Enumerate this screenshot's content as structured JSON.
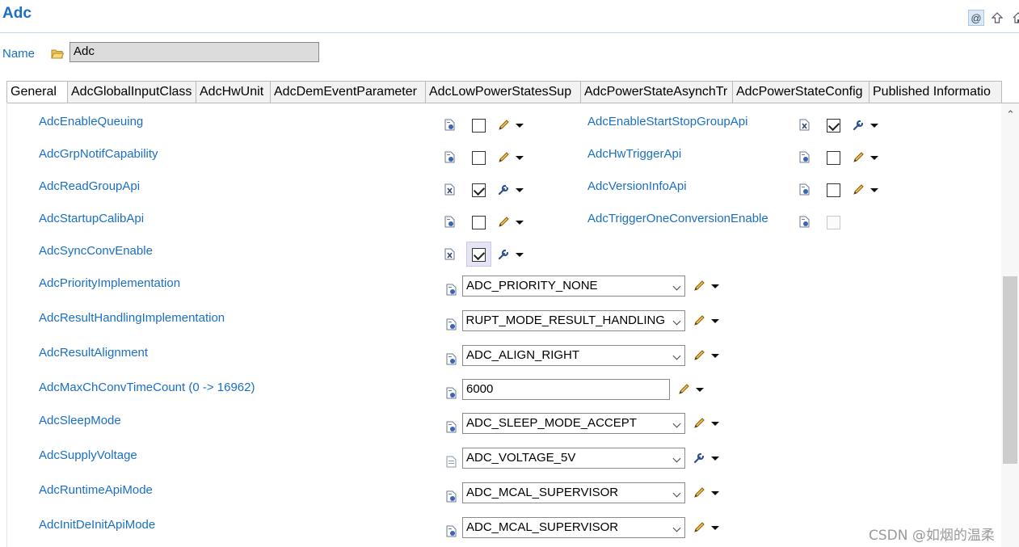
{
  "header": {
    "title": "Adc"
  },
  "header_icons": [
    "at-icon",
    "up-arrow-icon",
    "home-icon"
  ],
  "name_field": {
    "label": "Name",
    "value": "Adc"
  },
  "tabs": [
    {
      "label": "General",
      "active": true
    },
    {
      "label": "AdcGlobalInputClass"
    },
    {
      "label": "AdcHwUnit"
    },
    {
      "label": "AdcDemEventParameter"
    },
    {
      "label": "AdcLowPowerStatesSup"
    },
    {
      "label": "AdcPowerStateAsynchTr"
    },
    {
      "label": "AdcPowerStateConfig"
    },
    {
      "label": "Published Informatio"
    }
  ],
  "checkbox_rows": {
    "left": [
      {
        "label": "AdcEnableQueuing",
        "checked": false,
        "icon": "doc-pin-icon",
        "action_icon": "pencil-icon"
      },
      {
        "label": "AdcGrpNotifCapability",
        "checked": false,
        "icon": "doc-pin-icon",
        "action_icon": "pencil-icon"
      },
      {
        "label": "AdcReadGroupApi",
        "checked": true,
        "icon": "doc-x-icon",
        "action_icon": "wrench-icon"
      },
      {
        "label": "AdcStartupCalibApi",
        "checked": false,
        "icon": "doc-pin-icon",
        "action_icon": "pencil-icon"
      },
      {
        "label": "AdcSyncConvEnable",
        "checked": true,
        "icon": "doc-x-icon",
        "action_icon": "wrench-icon"
      }
    ],
    "right": [
      {
        "label": "AdcEnableStartStopGroupApi",
        "checked": true,
        "icon": "doc-x-icon",
        "action_icon": "wrench-icon"
      },
      {
        "label": "AdcHwTriggerApi",
        "checked": false,
        "icon": "doc-pin-icon",
        "action_icon": "pencil-icon"
      },
      {
        "label": "AdcVersionInfoApi",
        "checked": false,
        "icon": "doc-pin-icon",
        "action_icon": "pencil-icon"
      },
      {
        "label": "AdcTriggerOneConversionEnable",
        "checked": false,
        "disabled": true,
        "icon": "doc-pin-icon"
      }
    ]
  },
  "field_rows": [
    {
      "label": "AdcPriorityImplementation",
      "kind": "combo",
      "value": "ADC_PRIORITY_NONE",
      "action_icon": "pencil-icon"
    },
    {
      "label": "AdcResultHandlingImplementation",
      "kind": "combo",
      "value": "ADC_INTERRUPT_MODE_RESULT_HANDLING",
      "action_icon": "pencil-icon"
    },
    {
      "label": "AdcResultAlignment",
      "kind": "combo",
      "value": "ADC_ALIGN_RIGHT",
      "action_icon": "pencil-icon"
    },
    {
      "label": "AdcMaxChConvTimeCount (0 -> 16962)",
      "kind": "text",
      "value": "6000",
      "action_icon": "pencil-icon"
    },
    {
      "label": "AdcSleepMode",
      "kind": "combo",
      "value": "ADC_SLEEP_MODE_ACCEPT",
      "action_icon": "pencil-icon"
    },
    {
      "label": "AdcSupplyVoltage",
      "kind": "combo",
      "value": "ADC_VOLTAGE_5V",
      "action_icon": "wrench-icon"
    },
    {
      "label": "AdcRuntimeApiMode",
      "kind": "combo",
      "value": "ADC_MCAL_SUPERVISOR",
      "action_icon": "pencil-icon"
    },
    {
      "label": "AdcInitDeInitApiMode",
      "kind": "combo",
      "value": "ADC_MCAL_SUPERVISOR",
      "action_icon": "pencil-icon"
    }
  ],
  "watermark": "CSDN @如烟的温柔",
  "colors": {
    "label_blue": "#1a6fc4",
    "header_line": "#c5d6ea"
  }
}
